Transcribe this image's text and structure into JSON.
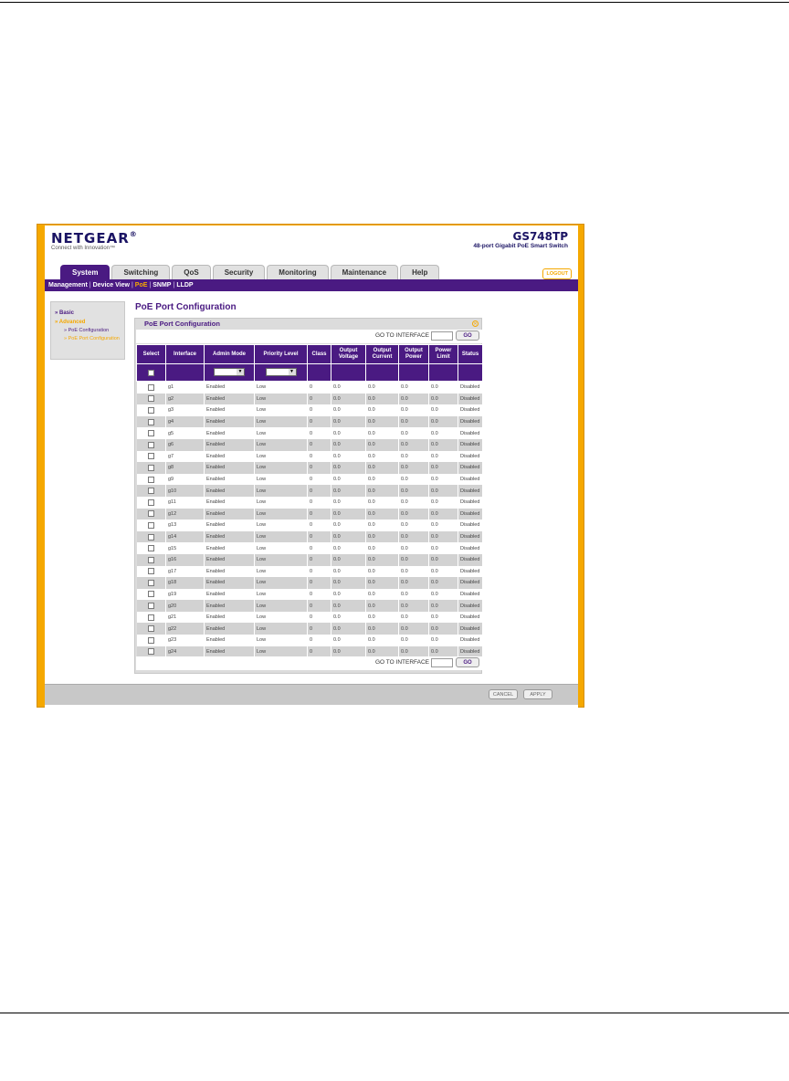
{
  "brand": {
    "logo": "NETGEAR",
    "trademark": "®",
    "tagline": "Connect with Innovation™"
  },
  "model": {
    "name": "GS748TP",
    "description": "48-port Gigabit PoE Smart Switch"
  },
  "tabs": [
    {
      "label": "System",
      "active": true
    },
    {
      "label": "Switching",
      "active": false
    },
    {
      "label": "QoS",
      "active": false
    },
    {
      "label": "Security",
      "active": false
    },
    {
      "label": "Monitoring",
      "active": false
    },
    {
      "label": "Maintenance",
      "active": false
    },
    {
      "label": "Help",
      "active": false
    }
  ],
  "logout_label": "LOGOUT",
  "subnav": [
    {
      "label": "Management",
      "active": false
    },
    {
      "label": "Device View",
      "active": false
    },
    {
      "label": "PoE",
      "active": true
    },
    {
      "label": "SNMP",
      "active": false
    },
    {
      "label": "LLDP",
      "active": false
    }
  ],
  "sidebar": {
    "basic": "» Basic",
    "advanced": "» Advanced",
    "items": [
      {
        "label": "» PoE Configuration",
        "active": false
      },
      {
        "label": "» PoE Port Configuration",
        "active": true
      }
    ]
  },
  "content_title": "PoE Port Configuration",
  "panel": {
    "title": "PoE Port Configuration",
    "goto_label": "GO TO INTERFACE",
    "goto_value": "",
    "go_button": "GO"
  },
  "table": {
    "columns": [
      "Select",
      "Interface",
      "Admin Mode",
      "Priority Level",
      "Class",
      "Output Voltage",
      "Output Current",
      "Output Power",
      "Power Limit",
      "Status"
    ],
    "rows": [
      [
        "g1",
        "Enabled",
        "Low",
        "0",
        "0.0",
        "0.0",
        "0.0",
        "0.0",
        "Disabled"
      ],
      [
        "g2",
        "Enabled",
        "Low",
        "0",
        "0.0",
        "0.0",
        "0.0",
        "0.0",
        "Disabled"
      ],
      [
        "g3",
        "Enabled",
        "Low",
        "0",
        "0.0",
        "0.0",
        "0.0",
        "0.0",
        "Disabled"
      ],
      [
        "g4",
        "Enabled",
        "Low",
        "0",
        "0.0",
        "0.0",
        "0.0",
        "0.0",
        "Disabled"
      ],
      [
        "g5",
        "Enabled",
        "Low",
        "0",
        "0.0",
        "0.0",
        "0.0",
        "0.0",
        "Disabled"
      ],
      [
        "g6",
        "Enabled",
        "Low",
        "0",
        "0.0",
        "0.0",
        "0.0",
        "0.0",
        "Disabled"
      ],
      [
        "g7",
        "Enabled",
        "Low",
        "0",
        "0.0",
        "0.0",
        "0.0",
        "0.0",
        "Disabled"
      ],
      [
        "g8",
        "Enabled",
        "Low",
        "0",
        "0.0",
        "0.0",
        "0.0",
        "0.0",
        "Disabled"
      ],
      [
        "g9",
        "Enabled",
        "Low",
        "0",
        "0.0",
        "0.0",
        "0.0",
        "0.0",
        "Disabled"
      ],
      [
        "g10",
        "Enabled",
        "Low",
        "0",
        "0.0",
        "0.0",
        "0.0",
        "0.0",
        "Disabled"
      ],
      [
        "g11",
        "Enabled",
        "Low",
        "0",
        "0.0",
        "0.0",
        "0.0",
        "0.0",
        "Disabled"
      ],
      [
        "g12",
        "Enabled",
        "Low",
        "0",
        "0.0",
        "0.0",
        "0.0",
        "0.0",
        "Disabled"
      ],
      [
        "g13",
        "Enabled",
        "Low",
        "0",
        "0.0",
        "0.0",
        "0.0",
        "0.0",
        "Disabled"
      ],
      [
        "g14",
        "Enabled",
        "Low",
        "0",
        "0.0",
        "0.0",
        "0.0",
        "0.0",
        "Disabled"
      ],
      [
        "g15",
        "Enabled",
        "Low",
        "0",
        "0.0",
        "0.0",
        "0.0",
        "0.0",
        "Disabled"
      ],
      [
        "g16",
        "Enabled",
        "Low",
        "0",
        "0.0",
        "0.0",
        "0.0",
        "0.0",
        "Disabled"
      ],
      [
        "g17",
        "Enabled",
        "Low",
        "0",
        "0.0",
        "0.0",
        "0.0",
        "0.0",
        "Disabled"
      ],
      [
        "g18",
        "Enabled",
        "Low",
        "0",
        "0.0",
        "0.0",
        "0.0",
        "0.0",
        "Disabled"
      ],
      [
        "g19",
        "Enabled",
        "Low",
        "0",
        "0.0",
        "0.0",
        "0.0",
        "0.0",
        "Disabled"
      ],
      [
        "g20",
        "Enabled",
        "Low",
        "0",
        "0.0",
        "0.0",
        "0.0",
        "0.0",
        "Disabled"
      ],
      [
        "g21",
        "Enabled",
        "Low",
        "0",
        "0.0",
        "0.0",
        "0.0",
        "0.0",
        "Disabled"
      ],
      [
        "g22",
        "Enabled",
        "Low",
        "0",
        "0.0",
        "0.0",
        "0.0",
        "0.0",
        "Disabled"
      ],
      [
        "g23",
        "Enabled",
        "Low",
        "0",
        "0.0",
        "0.0",
        "0.0",
        "0.0",
        "Disabled"
      ],
      [
        "g24",
        "Enabled",
        "Low",
        "0",
        "0.0",
        "0.0",
        "0.0",
        "0.0",
        "Disabled"
      ]
    ]
  },
  "footer": {
    "cancel": "CANCEL",
    "apply": "APPLY"
  },
  "colors": {
    "brand_purple": "#4a1a82",
    "accent_orange": "#f5a800",
    "row_alt": "#d2d2d2"
  }
}
